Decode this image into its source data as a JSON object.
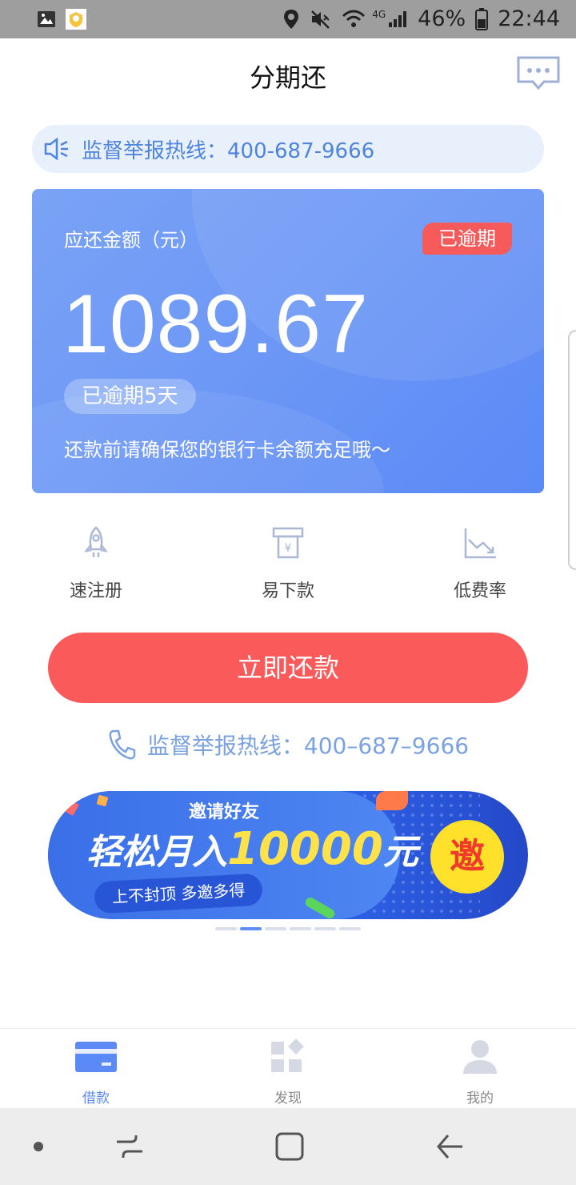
{
  "status_bar": {
    "network": "4G",
    "battery": "46%",
    "time": "22:44"
  },
  "header": {
    "title": "分期还"
  },
  "notice": {
    "text": "监督举报热线：400-687-9666"
  },
  "card": {
    "label": "应还金额（元）",
    "status_tag": "已逾期",
    "amount": "1089.67",
    "overdue_days": "已逾期5天",
    "tip": "还款前请确保您的银行卡余额充足哦～"
  },
  "features": [
    {
      "label": "速注册",
      "icon": "rocket-icon"
    },
    {
      "label": "易下款",
      "icon": "atm-yuan-icon"
    },
    {
      "label": "低费率",
      "icon": "trend-down-icon"
    }
  ],
  "repay_button": "立即还款",
  "hotline": {
    "text": "监督举报热线：400–687–9666",
    "icon": "phone-icon"
  },
  "banner": {
    "top_text": "邀请好友",
    "main_prefix": "轻松月入",
    "main_amount": "10000",
    "main_suffix": "元",
    "sub_text": "上不封顶 多邀多得",
    "badge": "邀"
  },
  "pager": {
    "count": 6,
    "active": 1
  },
  "tabbar": {
    "items": [
      {
        "label": "借款",
        "icon": "card-icon",
        "active": true
      },
      {
        "label": "发现",
        "icon": "discover-icon",
        "active": false
      },
      {
        "label": "我的",
        "icon": "user-icon",
        "active": false
      }
    ]
  },
  "colors": {
    "accent": "#5b8af7",
    "danger": "#fb5a5a",
    "notice_bg": "#e8f0fc"
  }
}
